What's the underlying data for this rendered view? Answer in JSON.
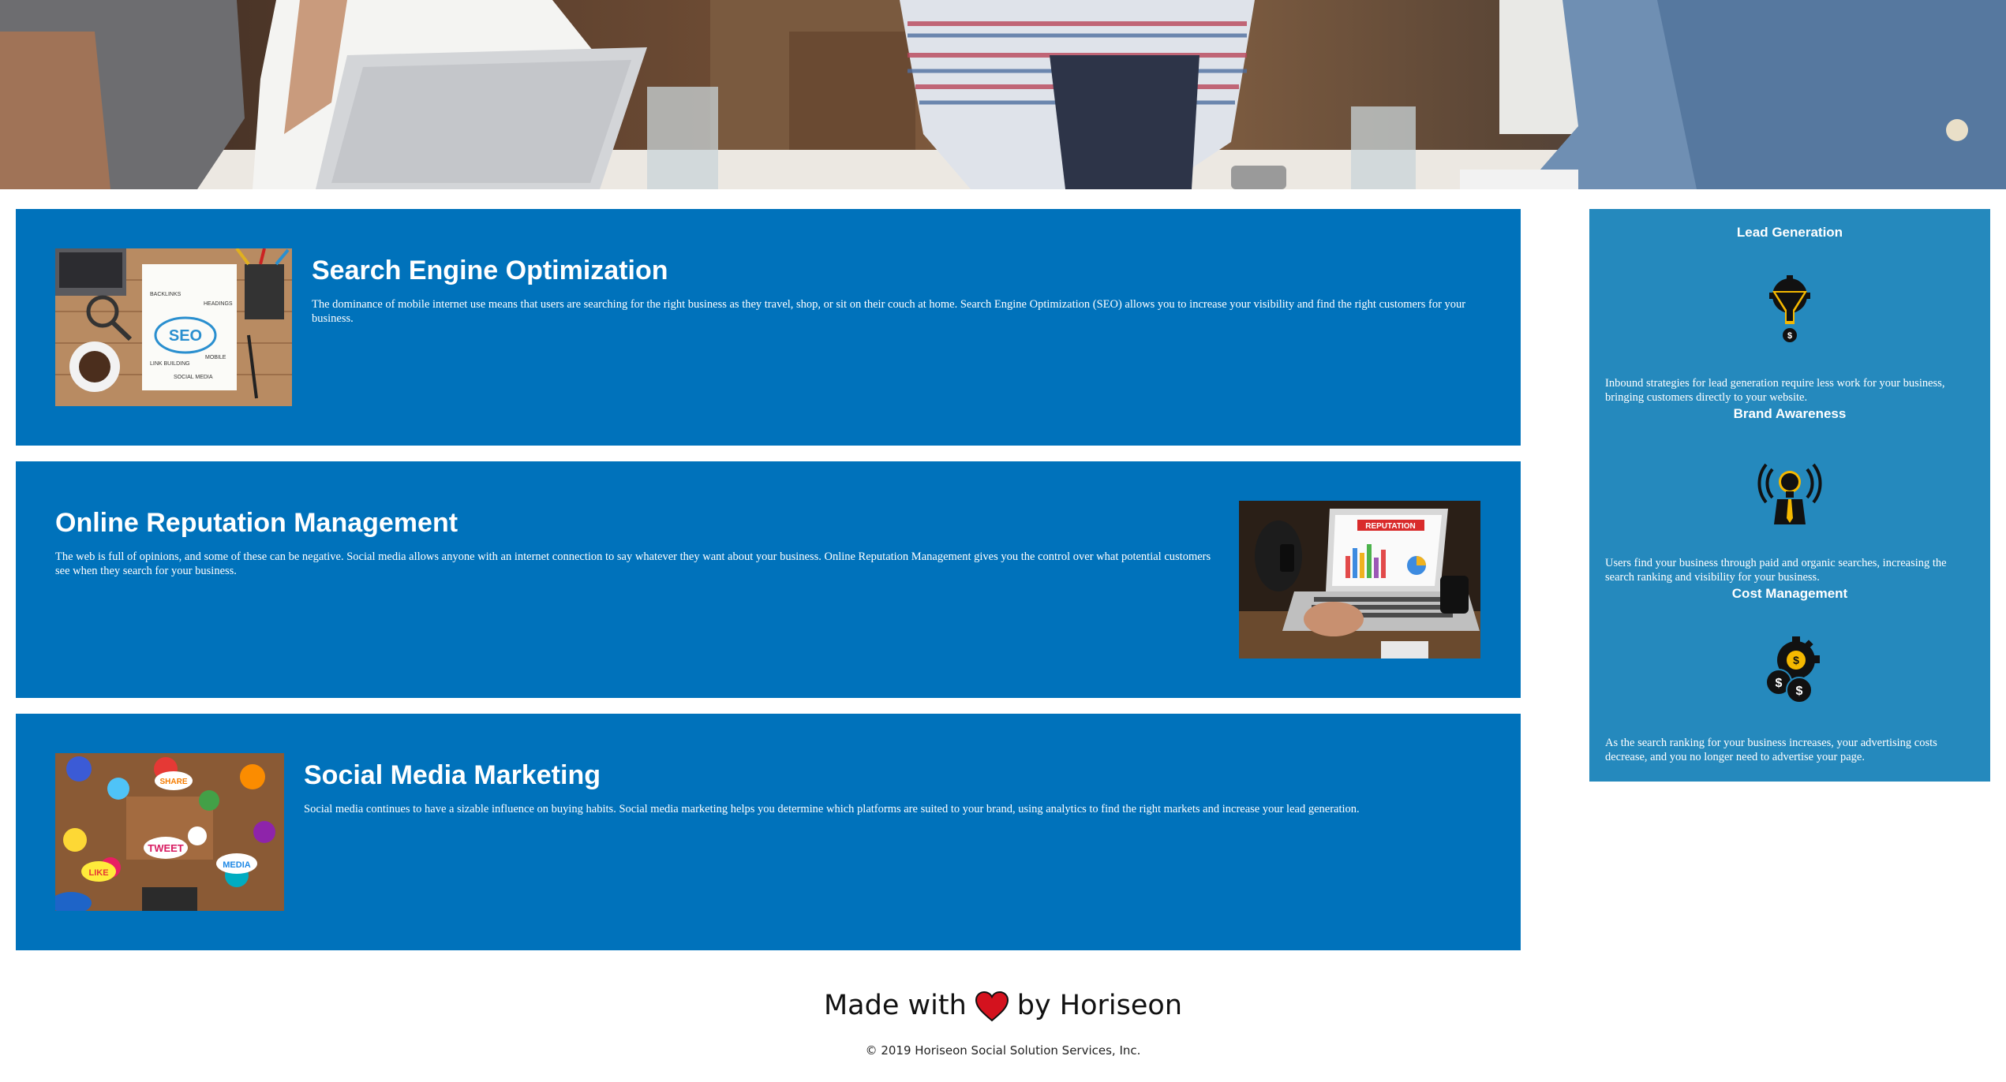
{
  "hero": {
    "image": "office-meeting-photo"
  },
  "services": [
    {
      "title": "Search Engine Optimization",
      "text": "The dominance of mobile internet use means that users are searching for the right business as they travel, shop, or sit on their couch at home. Search Engine Optimization (SEO) allows you to increase your visibility and find the right customers for your business.",
      "image": "seo-image"
    },
    {
      "title": "Online Reputation Management",
      "text": "The web is full of opinions, and some of these can be negative. Social media allows anyone with an internet connection to say whatever they want about your business. Online Reputation Management gives you the control over what potential customers see when they search for your business.",
      "image": "reputation-image"
    },
    {
      "title": "Social Media Marketing",
      "text": "Social media continues to have a sizable influence on buying habits. Social media marketing helps you determine which platforms are suited to your brand, using analytics to find the right markets and increase your lead generation.",
      "image": "social-media-image"
    }
  ],
  "sidebar": {
    "items": [
      {
        "title": "Lead Generation",
        "icon": "lead-generation-icon",
        "text": "Inbound strategies for lead generation require less work for your business, bringing customers directly to your website."
      },
      {
        "title": "Brand Awareness",
        "icon": "brand-awareness-icon",
        "text": "Users find your business through paid and organic searches, increasing the search ranking and visibility for your business."
      },
      {
        "title": "Cost Management",
        "icon": "cost-management-icon",
        "text": "As the search ranking for your business increases, your advertising costs decrease, and you no longer need to advertise your page."
      }
    ]
  },
  "footer": {
    "made_with": "Made with",
    "by": "by Horiseon",
    "heart_icon": "heart-icon",
    "copyright": "© 2019 Horiseon Social Solution Services, Inc."
  },
  "colors": {
    "card_blue": "#0072bb",
    "sidebar_blue": "#2589bd",
    "heart_red": "#d4121e"
  }
}
